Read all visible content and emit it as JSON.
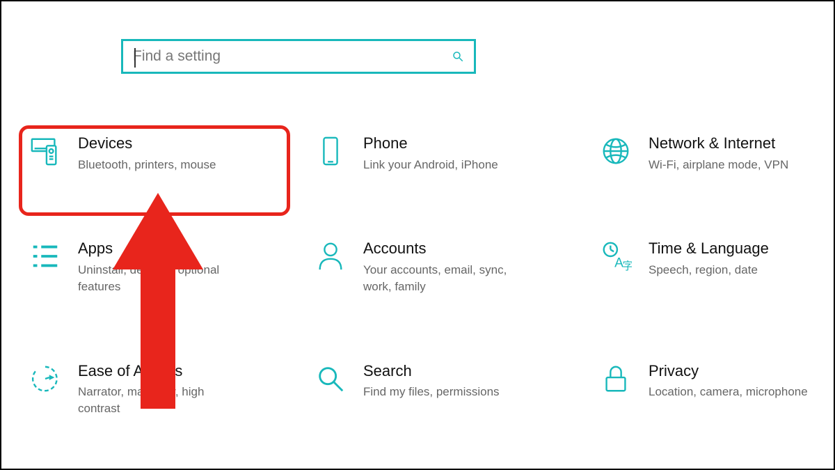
{
  "search": {
    "placeholder": "Find a setting"
  },
  "accent": "#18b8bb",
  "tiles": [
    {
      "title": "Devices",
      "subtitle": "Bluetooth, printers, mouse"
    },
    {
      "title": "Phone",
      "subtitle": "Link your Android, iPhone"
    },
    {
      "title": "Network & Internet",
      "subtitle": "Wi-Fi, airplane mode, VPN"
    },
    {
      "title": "Apps",
      "subtitle": "Uninstall, defaults, optional features"
    },
    {
      "title": "Accounts",
      "subtitle": "Your accounts, email, sync, work, family"
    },
    {
      "title": "Time & Language",
      "subtitle": "Speech, region, date"
    },
    {
      "title": "Ease of Access",
      "subtitle": "Narrator, magnifier, high contrast"
    },
    {
      "title": "Search",
      "subtitle": "Find my files, permissions"
    },
    {
      "title": "Privacy",
      "subtitle": "Location, camera, microphone"
    }
  ]
}
